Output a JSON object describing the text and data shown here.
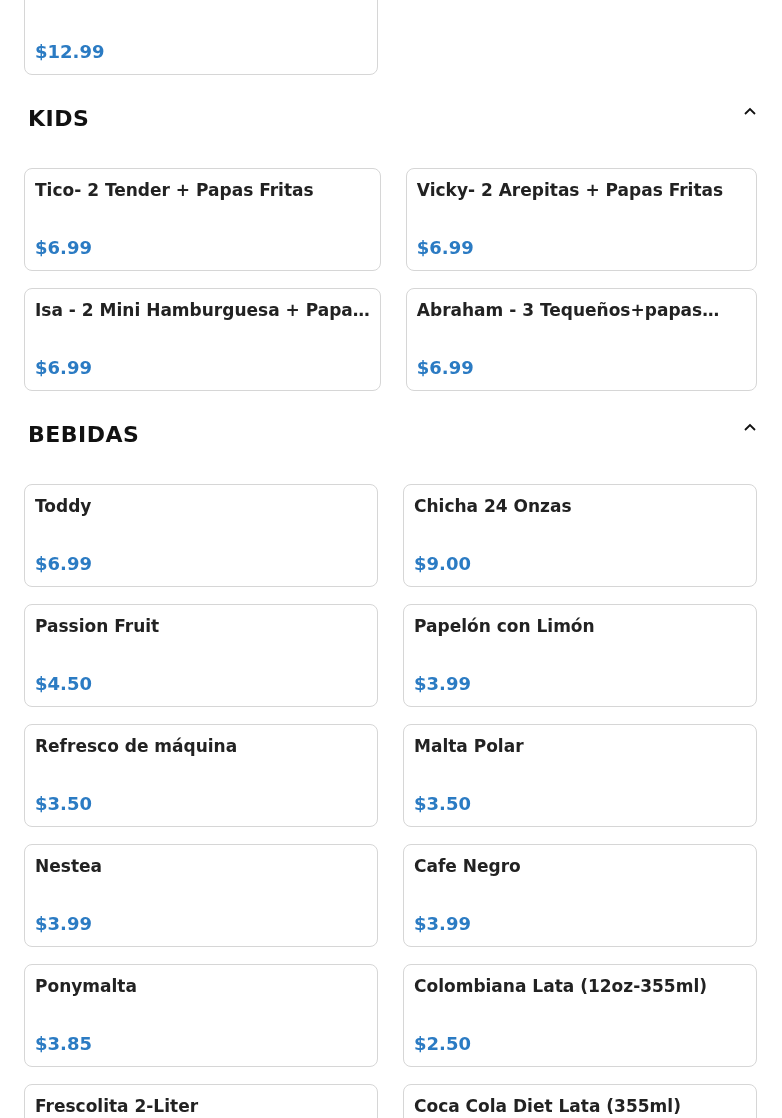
{
  "sections": [
    {
      "items": [
        {
          "price": "$12.99"
        }
      ]
    },
    {
      "title": "KIDS",
      "expanded": true,
      "items": [
        {
          "name": "Tico- 2 Tender + Papas Fritas",
          "price": "$6.99"
        },
        {
          "name": "Vicky- 2 Arepitas + Papas Fritas",
          "price": "$6.99"
        },
        {
          "name": "Isa - 2 Mini Hamburguesa + Papa…",
          "price": "$6.99"
        },
        {
          "name": "Abraham - 3 Tequeños+papas…",
          "price": "$6.99"
        }
      ]
    },
    {
      "title": "BEBIDAS",
      "expanded": true,
      "items": [
        {
          "name": "Toddy",
          "price": "$6.99"
        },
        {
          "name": "Chicha 24 Onzas",
          "price": "$9.00"
        },
        {
          "name": "Passion Fruit",
          "price": "$4.50"
        },
        {
          "name": "Papelón con Limón",
          "price": "$3.99"
        },
        {
          "name": "Refresco de máquina",
          "price": "$3.50"
        },
        {
          "name": "Malta Polar",
          "price": "$3.50"
        },
        {
          "name": "Nestea",
          "price": "$3.99"
        },
        {
          "name": "Cafe Negro",
          "price": "$3.99"
        },
        {
          "name": "Ponymalta",
          "price": "$3.85"
        },
        {
          "name": "Colombiana Lata (12oz-355ml)",
          "price": "$2.50"
        },
        {
          "name": "Frescolita 2-Liter"
        },
        {
          "name": "Coca Cola Diet Lata (355ml)"
        }
      ]
    }
  ]
}
